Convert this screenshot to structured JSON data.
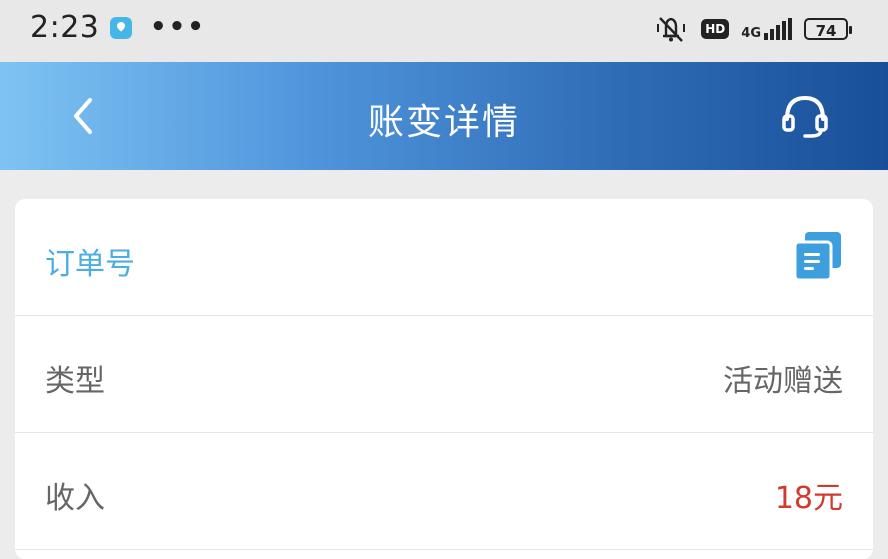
{
  "status_bar": {
    "time": "2:23",
    "icons": [
      "location-app-icon",
      "more-dots-icon",
      "mute-vibrate-icon",
      "hd-icon",
      "4g-signal-icon",
      "battery-icon"
    ],
    "dots": "•••",
    "hd": "HD",
    "network": "4G",
    "battery": "74"
  },
  "header": {
    "title": "账变详情",
    "back_icon": "chevron-left-icon",
    "support_icon": "headset-icon"
  },
  "details": {
    "order_label": "订单号",
    "copy_icon": "copy-icon",
    "type_label": "类型",
    "type_value": "活动赠送",
    "income_label": "收入",
    "income_value": "18元"
  },
  "colors": {
    "header_start": "#7ec3f2",
    "header_end": "#194f99",
    "accent_blue": "#4aaee0",
    "income_red": "#d03a2f"
  }
}
